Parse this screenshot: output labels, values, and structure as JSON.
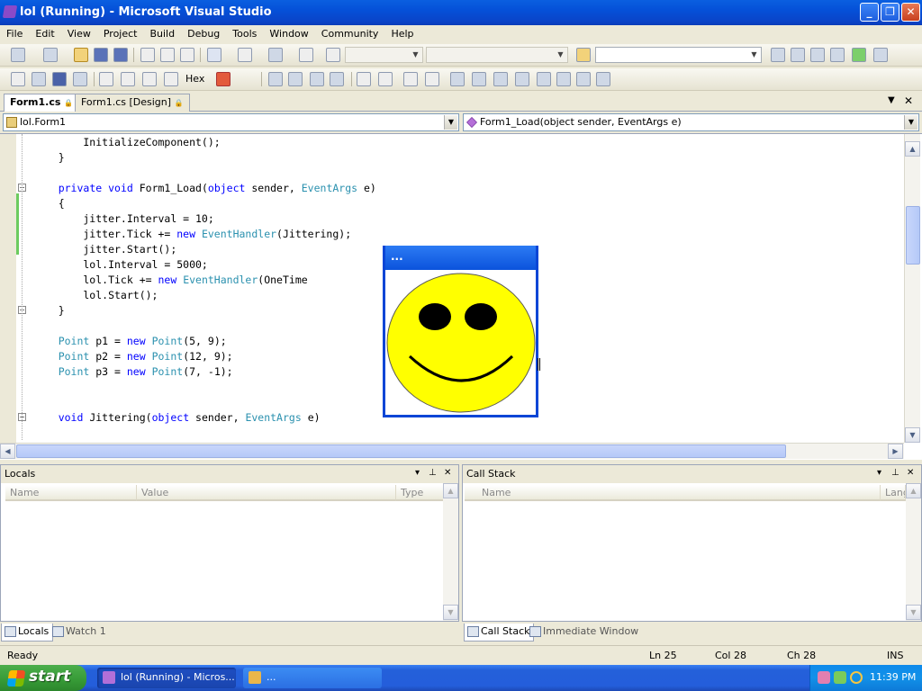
{
  "window": {
    "title": "lol (Running) - Microsoft Visual Studio",
    "minimize": "_",
    "restore": "❐",
    "close": "✕"
  },
  "menu": [
    "File",
    "Edit",
    "View",
    "Project",
    "Build",
    "Debug",
    "Tools",
    "Window",
    "Community",
    "Help"
  ],
  "toolbar2": {
    "hex_label": "Hex"
  },
  "doc_tabs": [
    {
      "label": "Form1.cs",
      "active": true
    },
    {
      "label": "Form1.cs [Design]",
      "active": false
    }
  ],
  "navbar": {
    "class_combo": "lol.Form1",
    "member_combo": "Form1_Load(object sender, EventArgs e)"
  },
  "code_lines": [
    [
      {
        "t": "        InitializeComponent();",
        "c": ""
      }
    ],
    [
      {
        "t": "    }",
        "c": ""
      }
    ],
    [
      {
        "t": "",
        "c": ""
      }
    ],
    [
      {
        "t": "    ",
        "c": ""
      },
      {
        "t": "private void ",
        "c": "kw"
      },
      {
        "t": "Form1_Load(",
        "c": ""
      },
      {
        "t": "object ",
        "c": "kw"
      },
      {
        "t": "sender, ",
        "c": ""
      },
      {
        "t": "EventArgs ",
        "c": "ty"
      },
      {
        "t": "e)",
        "c": ""
      }
    ],
    [
      {
        "t": "    {",
        "c": ""
      }
    ],
    [
      {
        "t": "        jitter.Interval = 10;",
        "c": ""
      }
    ],
    [
      {
        "t": "        jitter.Tick += ",
        "c": ""
      },
      {
        "t": "new ",
        "c": "kw"
      },
      {
        "t": "EventHandler",
        "c": "ty"
      },
      {
        "t": "(Jittering);",
        "c": ""
      }
    ],
    [
      {
        "t": "        jitter.Start();",
        "c": ""
      }
    ],
    [
      {
        "t": "        lol.Interval = 5000;",
        "c": ""
      }
    ],
    [
      {
        "t": "        lol.Tick += ",
        "c": ""
      },
      {
        "t": "new ",
        "c": "kw"
      },
      {
        "t": "EventHandler",
        "c": "ty"
      },
      {
        "t": "(OneTime",
        "c": ""
      }
    ],
    [
      {
        "t": "        lol.Start();",
        "c": ""
      }
    ],
    [
      {
        "t": "    }",
        "c": ""
      }
    ],
    [
      {
        "t": "",
        "c": ""
      }
    ],
    [
      {
        "t": "    ",
        "c": ""
      },
      {
        "t": "Point ",
        "c": "ty"
      },
      {
        "t": "p1 = ",
        "c": ""
      },
      {
        "t": "new ",
        "c": "kw"
      },
      {
        "t": "Point",
        "c": "ty"
      },
      {
        "t": "(5, 9);",
        "c": ""
      }
    ],
    [
      {
        "t": "    ",
        "c": ""
      },
      {
        "t": "Point ",
        "c": "ty"
      },
      {
        "t": "p2 = ",
        "c": ""
      },
      {
        "t": "new ",
        "c": "kw"
      },
      {
        "t": "Point",
        "c": "ty"
      },
      {
        "t": "(12, 9);",
        "c": ""
      }
    ],
    [
      {
        "t": "    ",
        "c": ""
      },
      {
        "t": "Point ",
        "c": "ty"
      },
      {
        "t": "p3 = ",
        "c": ""
      },
      {
        "t": "new ",
        "c": "kw"
      },
      {
        "t": "Point",
        "c": "ty"
      },
      {
        "t": "(7, -1);",
        "c": ""
      }
    ],
    [
      {
        "t": "",
        "c": ""
      }
    ],
    [
      {
        "t": "",
        "c": ""
      }
    ],
    [
      {
        "t": "    ",
        "c": ""
      },
      {
        "t": "void ",
        "c": "kw"
      },
      {
        "t": "Jittering(",
        "c": ""
      },
      {
        "t": "object ",
        "c": "kw"
      },
      {
        "t": "sender, ",
        "c": ""
      },
      {
        "t": "EventArgs ",
        "c": "ty"
      },
      {
        "t": "e)",
        "c": ""
      }
    ]
  ],
  "running_form": {
    "caption": "..."
  },
  "locals": {
    "title": "Locals",
    "columns": [
      "Name",
      "Value",
      "Type"
    ]
  },
  "callstack": {
    "title": "Call Stack",
    "columns": [
      "Name",
      "Langu"
    ]
  },
  "pane_buttons": {
    "dropdown": "▾",
    "pin": "📌",
    "close": "✕"
  },
  "bottom_tabs_left": [
    {
      "label": "Locals",
      "active": true
    },
    {
      "label": "Watch 1",
      "active": false
    }
  ],
  "bottom_tabs_right": [
    {
      "label": "Call Stack",
      "active": true
    },
    {
      "label": "Immediate Window",
      "active": false
    }
  ],
  "status": {
    "state": "Ready",
    "ln": "Ln 25",
    "col": "Col 28",
    "ch": "Ch 28",
    "mode": "INS"
  },
  "taskbar": {
    "start": "start",
    "buttons": [
      "lol (Running) - Micros...",
      "..."
    ],
    "clock": "11:39 PM"
  },
  "colors": {
    "keyword": "#0000ff",
    "type": "#2B91AF",
    "smiley": "#FFFF00"
  }
}
